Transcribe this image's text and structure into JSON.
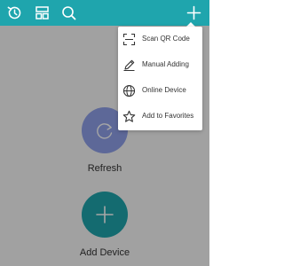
{
  "topbar": {
    "icons": [
      "history-icon",
      "layout-icon",
      "search-icon",
      "add-icon"
    ],
    "color": "#1fa5ad"
  },
  "main": {
    "refresh": {
      "label": "Refresh",
      "icon": "refresh-icon",
      "color": "#8fa0ea"
    },
    "add_device": {
      "label": "Add Device",
      "icon": "add-icon",
      "color": "#1fa5ad"
    }
  },
  "menu": {
    "items": [
      {
        "label": "Scan QR Code",
        "icon": "qr-scan-icon"
      },
      {
        "label": "Manual Adding",
        "icon": "pencil-icon"
      },
      {
        "label": "Online Device",
        "icon": "globe-icon"
      },
      {
        "label": "Add to Favorites",
        "icon": "star-icon"
      }
    ]
  }
}
